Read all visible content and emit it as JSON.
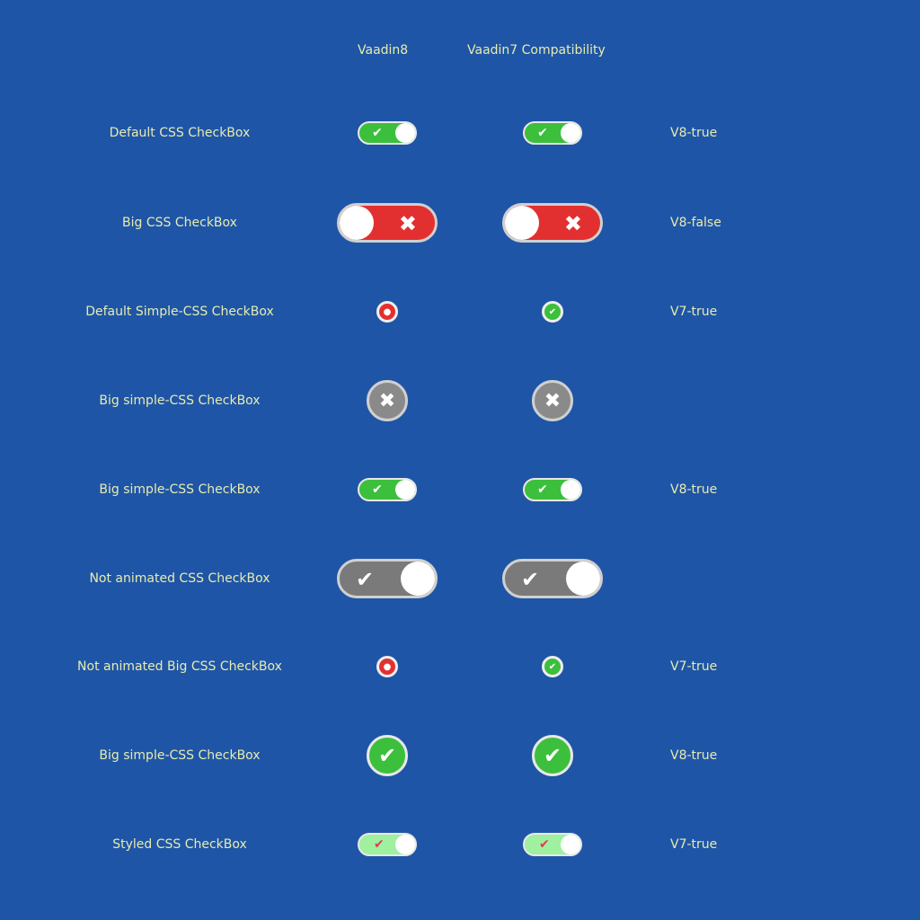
{
  "headers": {
    "col1": "Vaadin8",
    "col2": "Vaadin7 Compatibility"
  },
  "rows": [
    {
      "label": "Default CSS CheckBox",
      "value": "V8-true",
      "style": "small-toggle",
      "checked": true,
      "glyph": "✔"
    },
    {
      "label": "Big CSS CheckBox",
      "value": "V8-false",
      "style": "big-toggle-red",
      "checked": false,
      "glyph": "✖"
    },
    {
      "label": "Default Simple-CSS CheckBox",
      "value": "V7-true",
      "style": "small-circle",
      "v8_checked": false,
      "v7_checked": true,
      "v8_glyph": "●",
      "v7_glyph": "✔"
    },
    {
      "label": "Big simple-CSS CheckBox",
      "value": "",
      "style": "big-circle-gray",
      "checked": false,
      "glyph": "✖"
    },
    {
      "label": "Big simple-CSS CheckBox",
      "value": "V8-true",
      "style": "small-toggle",
      "checked": true,
      "glyph": "✔"
    },
    {
      "label": "Not animated CSS CheckBox",
      "value": "",
      "style": "big-toggle-gray",
      "checked": true,
      "glyph": "✔"
    },
    {
      "label": "Not animated Big CSS CheckBox",
      "value": "V7-true",
      "style": "small-circle",
      "v8_checked": false,
      "v7_checked": true,
      "v8_glyph": "●",
      "v7_glyph": "✔"
    },
    {
      "label": "Big simple-CSS CheckBox",
      "value": "V8-true",
      "style": "big-circle-green",
      "checked": true,
      "glyph": "✔"
    },
    {
      "label": "Styled CSS CheckBox",
      "value": "V7-true",
      "style": "styled-toggle",
      "checked": true,
      "glyph": "✔"
    }
  ],
  "colors": {
    "background": "#1f55a6",
    "text": "#e6ecb0",
    "green": "#3cbf3c",
    "red": "#e23030",
    "gray": "#7a7a7a"
  }
}
